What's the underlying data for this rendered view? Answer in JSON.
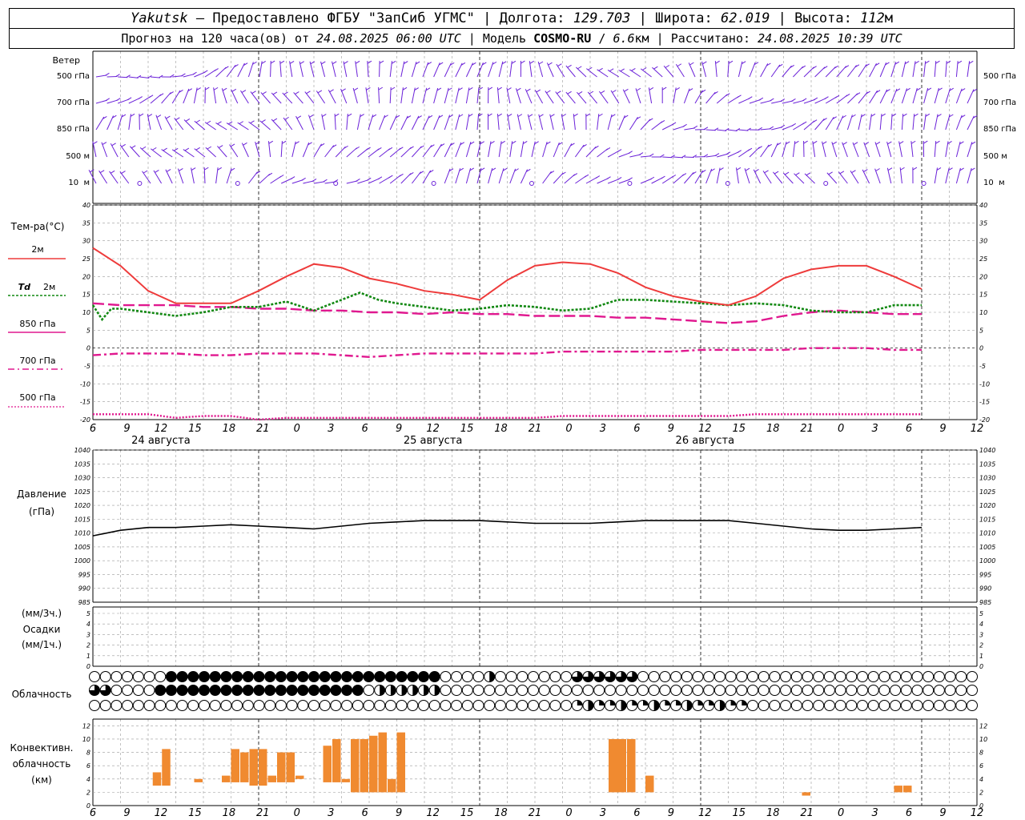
{
  "header": {
    "place": "Yakutsk",
    "provider": "– Предоставлено ФГБУ \"ЗапСиб УГМС\"",
    "lon_label": "Долгота:",
    "lon": "129.703",
    "lat_label": "Широта:",
    "lat": "62.019",
    "alt_label": "Высота:",
    "alt": "112",
    "alt_unit": "м",
    "forecast_prefix": "Прогноз на 120 часа(ов) от",
    "forecast_start": "24.08.2025 06:00 UTC",
    "model_label": "Модель",
    "model": "COSMO-RU",
    "resolution": "6.6",
    "resolution_unit": "км",
    "computed_label": "Рассчитано:",
    "computed": "24.08.2025 10:39 UTC"
  },
  "labels": {
    "wind": "Ветер",
    "wind_levels": [
      "500 гПа",
      "700 гПа",
      "850 гПа",
      "500 м",
      "10  м"
    ],
    "temp_title": "Тем-ра(°C)",
    "t2m": "2м",
    "td_a": "Td",
    "td_b": "2м",
    "t850": "850 гПа",
    "t700": "700 гПа",
    "t500": "500 гПа",
    "pressure_a": "Давление",
    "pressure_b": "(гПа)",
    "precip_a": "(мм/3ч.)",
    "precip_b": "Осадки",
    "precip_c": "(мм/1ч.)",
    "cloud": "Облачность",
    "conv_a": "Конвективн.",
    "conv_b": "облачность",
    "conv_c": "(км)"
  },
  "colors": {
    "t2m": "#ee3b3b",
    "td2m": "#118811",
    "upper": "#e0188f",
    "wind": "#6a20d8",
    "pressure": "#000000",
    "conv": "#f08a30",
    "grid": "#9a9a9a"
  },
  "chart_data": {
    "type": "meteogram",
    "hours": [
      6,
      9,
      12,
      15,
      18,
      21,
      0,
      3,
      6,
      9,
      12,
      15,
      18,
      21,
      0,
      3,
      6,
      9,
      12,
      15,
      18,
      21,
      0,
      3,
      6,
      9,
      12
    ],
    "dates": [
      {
        "label": "24 августа",
        "hour_index": 2
      },
      {
        "label": "25 августа",
        "hour_index": 10
      },
      {
        "label": "26 августа",
        "hour_index": 18
      }
    ],
    "temperature": {
      "ylim": [
        -20,
        40
      ],
      "ticks": [
        40,
        35,
        30,
        25,
        20,
        15,
        10,
        5,
        0,
        -5,
        -10,
        -15,
        -20
      ],
      "t2m": [
        [
          6,
          28
        ],
        [
          9,
          23
        ],
        [
          12,
          16
        ],
        [
          15,
          12.5
        ],
        [
          18,
          12.5
        ],
        [
          21,
          12.5
        ],
        [
          24,
          16
        ],
        [
          27,
          20
        ],
        [
          30,
          23.5
        ],
        [
          33,
          22.5
        ],
        [
          36,
          19.5
        ],
        [
          39,
          18
        ],
        [
          42,
          16
        ],
        [
          45,
          15
        ],
        [
          48,
          13.5
        ],
        [
          51,
          19
        ],
        [
          54,
          23
        ],
        [
          57,
          24
        ],
        [
          60,
          23.5
        ],
        [
          63,
          21
        ],
        [
          66,
          17
        ],
        [
          69,
          14.5
        ],
        [
          72,
          13
        ],
        [
          75,
          12
        ],
        [
          78,
          14.5
        ],
        [
          81,
          19.5
        ],
        [
          84,
          22
        ],
        [
          87,
          23
        ],
        [
          90,
          23
        ],
        [
          93,
          20
        ],
        [
          96,
          16.5
        ]
      ],
      "td2m": [
        [
          6,
          12
        ],
        [
          7,
          8
        ],
        [
          8,
          11
        ],
        [
          9,
          11
        ],
        [
          12,
          10
        ],
        [
          15,
          9
        ],
        [
          18,
          10
        ],
        [
          21,
          11.5
        ],
        [
          24,
          11.5
        ],
        [
          27,
          13
        ],
        [
          30,
          10.5
        ],
        [
          33,
          13.5
        ],
        [
          35,
          15.5
        ],
        [
          37,
          13.5
        ],
        [
          39,
          12.5
        ],
        [
          42,
          11.5
        ],
        [
          45,
          10.5
        ],
        [
          48,
          11
        ],
        [
          51,
          12
        ],
        [
          54,
          11.5
        ],
        [
          57,
          10.5
        ],
        [
          60,
          11
        ],
        [
          63,
          13.5
        ],
        [
          66,
          13.5
        ],
        [
          69,
          13
        ],
        [
          72,
          12.5
        ],
        [
          75,
          12
        ],
        [
          78,
          12.5
        ],
        [
          81,
          12
        ],
        [
          84,
          10.5
        ],
        [
          87,
          10
        ],
        [
          90,
          10
        ],
        [
          93,
          12
        ],
        [
          96,
          12
        ]
      ],
      "t850": [
        [
          6,
          12.5
        ],
        [
          9,
          12
        ],
        [
          12,
          12
        ],
        [
          15,
          12
        ],
        [
          18,
          11.5
        ],
        [
          21,
          11.5
        ],
        [
          24,
          11
        ],
        [
          27,
          11
        ],
        [
          30,
          10.5
        ],
        [
          33,
          10.5
        ],
        [
          36,
          10
        ],
        [
          39,
          10
        ],
        [
          42,
          9.5
        ],
        [
          45,
          10
        ],
        [
          48,
          9.5
        ],
        [
          51,
          9.5
        ],
        [
          54,
          9
        ],
        [
          57,
          9
        ],
        [
          60,
          9
        ],
        [
          63,
          8.5
        ],
        [
          66,
          8.5
        ],
        [
          69,
          8
        ],
        [
          72,
          7.5
        ],
        [
          75,
          7
        ],
        [
          78,
          7.5
        ],
        [
          81,
          9
        ],
        [
          84,
          10
        ],
        [
          87,
          10.5
        ],
        [
          90,
          10
        ],
        [
          93,
          9.5
        ],
        [
          96,
          9.5
        ]
      ],
      "t700": [
        [
          6,
          -2
        ],
        [
          9,
          -1.5
        ],
        [
          12,
          -1.5
        ],
        [
          15,
          -1.5
        ],
        [
          18,
          -2
        ],
        [
          21,
          -2
        ],
        [
          24,
          -1.5
        ],
        [
          27,
          -1.5
        ],
        [
          30,
          -1.5
        ],
        [
          33,
          -2
        ],
        [
          36,
          -2.5
        ],
        [
          39,
          -2
        ],
        [
          42,
          -1.5
        ],
        [
          45,
          -1.5
        ],
        [
          48,
          -1.5
        ],
        [
          51,
          -1.5
        ],
        [
          54,
          -1.5
        ],
        [
          57,
          -1
        ],
        [
          60,
          -1
        ],
        [
          63,
          -1
        ],
        [
          66,
          -1
        ],
        [
          69,
          -1
        ],
        [
          72,
          -0.5
        ],
        [
          75,
          -0.5
        ],
        [
          78,
          -0.5
        ],
        [
          81,
          -0.5
        ],
        [
          84,
          0
        ],
        [
          87,
          0
        ],
        [
          90,
          0
        ],
        [
          93,
          -0.5
        ],
        [
          96,
          -0.5
        ]
      ],
      "t500": [
        [
          6,
          -18.5
        ],
        [
          9,
          -18.5
        ],
        [
          12,
          -18.5
        ],
        [
          15,
          -19.5
        ],
        [
          18,
          -19
        ],
        [
          21,
          -19
        ],
        [
          24,
          -20
        ],
        [
          27,
          -19.5
        ],
        [
          30,
          -19.5
        ],
        [
          33,
          -19.5
        ],
        [
          36,
          -19.5
        ],
        [
          39,
          -19.5
        ],
        [
          42,
          -19.5
        ],
        [
          45,
          -19.5
        ],
        [
          48,
          -19.5
        ],
        [
          51,
          -19.5
        ],
        [
          54,
          -19.5
        ],
        [
          57,
          -19
        ],
        [
          60,
          -19
        ],
        [
          63,
          -19
        ],
        [
          66,
          -19
        ],
        [
          69,
          -19
        ],
        [
          72,
          -19
        ],
        [
          75,
          -19
        ],
        [
          78,
          -18.5
        ],
        [
          81,
          -18.5
        ],
        [
          84,
          -18.5
        ],
        [
          87,
          -18.5
        ],
        [
          90,
          -18.5
        ],
        [
          93,
          -18.5
        ],
        [
          96,
          -18.5
        ]
      ]
    },
    "pressure": {
      "ylim": [
        985,
        1040
      ],
      "ticks": [
        1040,
        1035,
        1030,
        1025,
        1020,
        1015,
        1010,
        1005,
        1000,
        995,
        990,
        985
      ],
      "values": [
        [
          6,
          1009
        ],
        [
          9,
          1011
        ],
        [
          12,
          1012
        ],
        [
          15,
          1012
        ],
        [
          18,
          1012.5
        ],
        [
          21,
          1013
        ],
        [
          24,
          1012.5
        ],
        [
          27,
          1012
        ],
        [
          30,
          1011.5
        ],
        [
          33,
          1012.5
        ],
        [
          36,
          1013.5
        ],
        [
          39,
          1014
        ],
        [
          42,
          1014.5
        ],
        [
          45,
          1014.5
        ],
        [
          48,
          1014.5
        ],
        [
          51,
          1014
        ],
        [
          54,
          1013.5
        ],
        [
          57,
          1013.5
        ],
        [
          60,
          1013.5
        ],
        [
          63,
          1014
        ],
        [
          66,
          1014.5
        ],
        [
          69,
          1014.5
        ],
        [
          72,
          1014.5
        ],
        [
          75,
          1014.5
        ],
        [
          78,
          1013.5
        ],
        [
          81,
          1012.5
        ],
        [
          84,
          1011.5
        ],
        [
          87,
          1011
        ],
        [
          90,
          1011
        ],
        [
          93,
          1011.5
        ],
        [
          96,
          1012
        ]
      ]
    },
    "precipitation": {
      "ylim": [
        0,
        5
      ],
      "ticks": [
        5,
        4,
        3,
        2,
        1,
        0
      ],
      "values": []
    },
    "convective_cloud": {
      "ylim": [
        0,
        13
      ],
      "ticks": [
        12,
        10,
        8,
        6,
        4,
        2,
        0
      ],
      "bars": [
        [
          6.5,
          7.5,
          3,
          5
        ],
        [
          7.5,
          8.5,
          3,
          8.5
        ],
        [
          11,
          12,
          3.5,
          4
        ],
        [
          14,
          15,
          3.5,
          4.5
        ],
        [
          15,
          16,
          3.5,
          8.5
        ],
        [
          16,
          17,
          3.5,
          8
        ],
        [
          17,
          18,
          3,
          8.5
        ],
        [
          18,
          19,
          3,
          8.5
        ],
        [
          19,
          20,
          3.5,
          4.5
        ],
        [
          20,
          21,
          3.5,
          8
        ],
        [
          21,
          22,
          3.5,
          8
        ],
        [
          22,
          23,
          4,
          4.5
        ],
        [
          23,
          24,
          4,
          4
        ],
        [
          24,
          25,
          4,
          4
        ],
        [
          25,
          26,
          3.5,
          9
        ],
        [
          26,
          27,
          3.5,
          10
        ],
        [
          27,
          28,
          3.5,
          4
        ],
        [
          28,
          29,
          2,
          10
        ],
        [
          29,
          30,
          2,
          10
        ],
        [
          30,
          31,
          2,
          10.5
        ],
        [
          31,
          32,
          2,
          11
        ],
        [
          32,
          33,
          2,
          4
        ],
        [
          33,
          34,
          2,
          11
        ],
        [
          34,
          35,
          4,
          4
        ],
        [
          35,
          36,
          4,
          4
        ],
        [
          56,
          58,
          2,
          10
        ],
        [
          58,
          59,
          2,
          10
        ],
        [
          60,
          61,
          2,
          4.5
        ],
        [
          63,
          64,
          2,
          2
        ],
        [
          77,
          78,
          1.5,
          2
        ],
        [
          87,
          88,
          2,
          3
        ],
        [
          88,
          89,
          2,
          3
        ]
      ]
    }
  }
}
